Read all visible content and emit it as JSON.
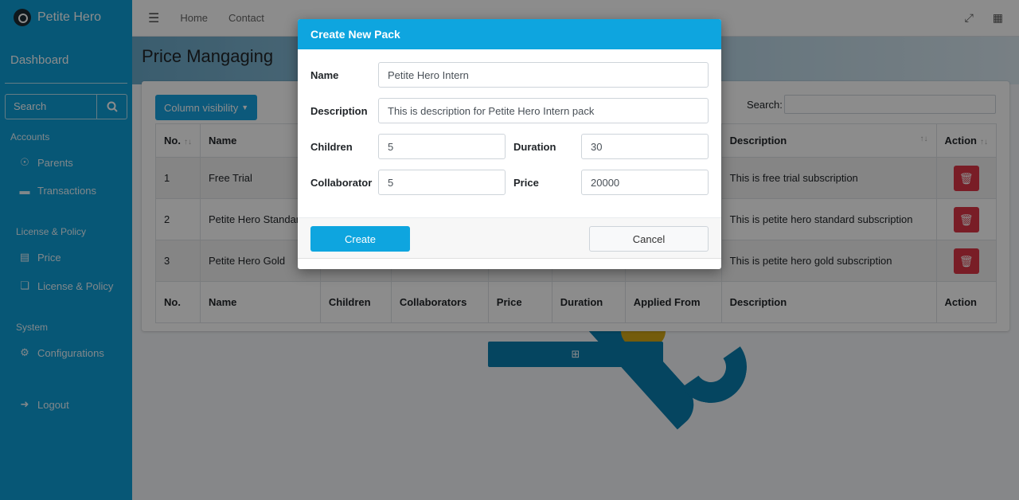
{
  "sidebar": {
    "brand": "Petite Hero",
    "dashboard": "Dashboard",
    "search_placeholder": "Search",
    "sections": [
      {
        "header": "Accounts",
        "items": [
          {
            "label": "Parents",
            "icon": "users-icon"
          },
          {
            "label": "Transactions",
            "icon": "credit-card-icon"
          }
        ]
      },
      {
        "header": "License & Policy",
        "items": [
          {
            "label": "Price",
            "icon": "money-icon"
          },
          {
            "label": "License & Policy",
            "icon": "copy-icon"
          }
        ]
      },
      {
        "header": "System",
        "items": [
          {
            "label": "Configurations",
            "icon": "cogs-icon"
          }
        ]
      }
    ],
    "logout": "Logout"
  },
  "topnav": {
    "links": [
      "Home",
      "Contact"
    ]
  },
  "page": {
    "title": "Price Mangaging",
    "column_visibility": "Column visibility",
    "search_label": "Search:",
    "table": {
      "headers": [
        "No.",
        "Name",
        "Children",
        "Collaborators",
        "Price",
        "Duration",
        "Applied From",
        "Description",
        "Action"
      ],
      "rows": [
        {
          "no": "1",
          "name": "Free Trial",
          "description": "This is free trial subscription"
        },
        {
          "no": "2",
          "name": "Petite Hero Standard",
          "description": "This is petite hero standard subscription"
        },
        {
          "no": "3",
          "name": "Petite Hero Gold",
          "description": "This is petite hero gold subscription"
        }
      ]
    }
  },
  "modal": {
    "title": "Create New Pack",
    "fields": {
      "name": {
        "label": "Name",
        "value": "Petite Hero Intern"
      },
      "description": {
        "label": "Description",
        "value": "This is description for Petite Hero Intern pack"
      },
      "children": {
        "label": "Children",
        "value": "5"
      },
      "duration": {
        "label": "Duration",
        "value": "30"
      },
      "collaborator": {
        "label": "Collaborator",
        "value": "5"
      },
      "price": {
        "label": "Price",
        "value": "20000"
      }
    },
    "create_label": "Create",
    "cancel_label": "Cancel"
  },
  "colors": {
    "sidebar": "#0e9fd8",
    "primary": "#0ea5df",
    "danger": "#dc3545"
  }
}
